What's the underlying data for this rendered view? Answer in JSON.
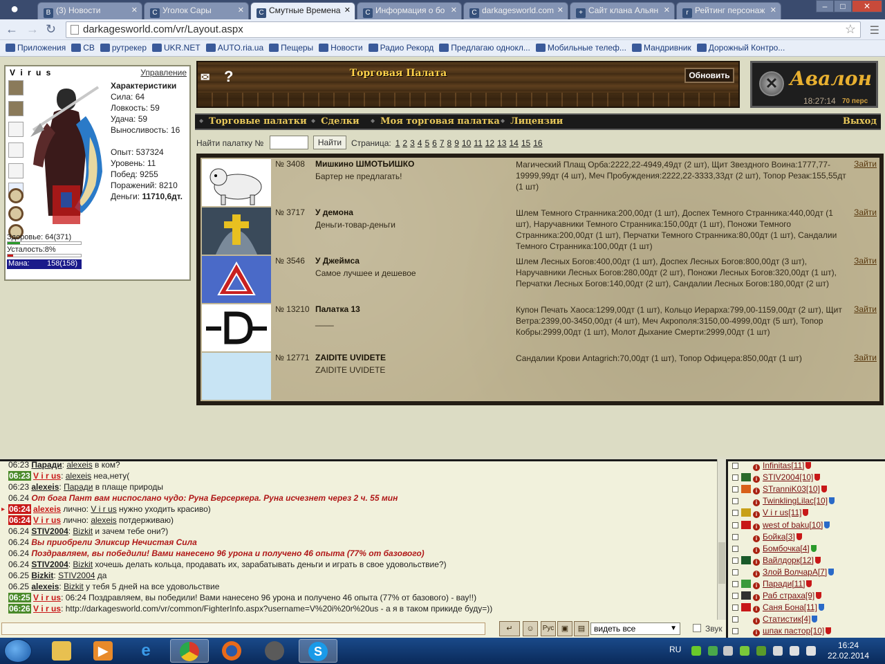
{
  "browser": {
    "tabs": [
      {
        "label": "(3) Новости",
        "fav": "B"
      },
      {
        "label": "Уголок Сары",
        "fav": "C"
      },
      {
        "label": "Смутные Времена",
        "fav": "C"
      },
      {
        "label": "Информация о бо",
        "fav": "C"
      },
      {
        "label": "darkagesworld.com",
        "fav": "C"
      },
      {
        "label": "Сайт клана Альян",
        "fav": "+"
      },
      {
        "label": "Рейтинг персонаж",
        "fav": "r"
      }
    ],
    "url": "darkagesworld.com/vr/Layout.aspx",
    "bookmarks": [
      "Приложения",
      "СВ",
      "рутрекер",
      "UKR.NET",
      "AUTO.ria.ua",
      "Пещеры",
      "Новости",
      "Радио Рекорд",
      "Предлагаю однокл...",
      "Мобильные телеф...",
      "Мандривник",
      "Дорожный Контро..."
    ]
  },
  "character": {
    "name": "V i r u s",
    "manage_label": "Управление",
    "stats_header": "Характеристики",
    "stats": [
      "Сила: 64",
      "Ловкость: 59",
      "Удача: 59",
      "Выносливость: 16"
    ],
    "progress": [
      "Опыт: 537324",
      "Уровень: 11",
      "Побед: 9255",
      "Поражений: 8210"
    ],
    "money_label": "Деньги: ",
    "money_value": "11710,6дт.",
    "health_label": "Здоровье:",
    "health_value": "64(371)",
    "health_fraction": 0.17,
    "fatigue_label": "Усталость:8%",
    "fatigue_fraction": 0.08,
    "mana_label": "Мана:",
    "mana_value": "158(158)",
    "colors": {
      "health": "#2a9a2a",
      "fatigue": "#c81818",
      "mana": "#1a1a8a"
    }
  },
  "header": {
    "title": "Торговая Палата",
    "refresh_label": "Обновить",
    "help_icon": "question-icon",
    "mail_icon": "letter-icon"
  },
  "server": {
    "name": "Авалон",
    "time": "18:27:14",
    "online": "70 перс"
  },
  "nav": {
    "items": [
      "Торговые палатки",
      "Сделки",
      "Моя торговая палатка",
      "Лицензии"
    ],
    "exit_label": "Выход"
  },
  "search": {
    "label": "Найти палатку №",
    "button_label": "Найти",
    "pages_label": "Страница:",
    "pages": [
      "1",
      "2",
      "3",
      "4",
      "5",
      "6",
      "7",
      "8",
      "9",
      "10",
      "11",
      "12",
      "13",
      "14",
      "15",
      "16"
    ]
  },
  "shops": [
    {
      "num": "№ 3408",
      "name": "Мишкино ШМОТЬИШКО",
      "motto": "Бартер не предлагать!",
      "goods": "Магический Плащ Орба:2222,22-4949,49дт (2 шт), Щит Звездного Воина:1777,77-19999,99дт (4 шт), Меч Пробуждения:2222,22-3333,33дт (2 шт), Топор Резак:155,55дт (1 шт)",
      "enter": "Зайти",
      "image": "bear-image"
    },
    {
      "num": "№ 3717",
      "name": "У демона",
      "motto": "Деньги-товар-деньги",
      "goods": "Шлем Темного Странника:200,00дт (1 шт), Доспех Темного Странника:440,00дт (1 шт), Наручавники Темного Странника:150,00дт (1 шт), Поножи Темного Странника:200,00дт (1 шт), Перчатки Темного Странника:80,00дт (1 шт), Сандалии Темного Странника:100,00дт (1 шт)",
      "enter": "Зайти",
      "image": "cross-knight-image"
    },
    {
      "num": "№ 3546",
      "name": "У Джеймса",
      "motto": "Самое лучшее и дешевое",
      "goods": "Шлем Лесных Богов:400,00дт (1 шт), Доспех Лесных Богов:800,00дт (3 шт), Наручавники Лесных Богов:280,00дт (2 шт), Поножи Лесных Богов:320,00дт (1 шт), Перчатки Лесных Богов:140,00дт (2 шт), Сандалии Лесных Богов:180,00дт (2 шт)",
      "enter": "Зайти",
      "image": "triangle-emblem-image"
    },
    {
      "num": "№ 13210",
      "name": "Палатка 13",
      "motto": "____",
      "goods": "Купон Печать Хаоса:1299,00дт (1 шт), Кольцо Иерарха:799,00-1159,00дт (2 шт), Щит Ветра:2399,00-3450,00дт (4 шт), Меч Акрополя:3150,00-4999,00дт (5 шт), Топор Кобры:2999,00дт (1 шт), Молот Дыхание Смерти:2999,00дт (1 шт)",
      "enter": "Зайти",
      "image": "letter-d-image"
    },
    {
      "num": "№ 12771",
      "name": "ZAIDITE UVIDETE",
      "motto": "ZAIDITE UVIDETE",
      "goods": "Сандалии Крови Antagrich:70,00дт (1 шт), Топор Офицера:850,00дт (1 шт)",
      "enter": "Зайти",
      "image": "blank-image"
    }
  ],
  "chat": [
    {
      "time": "06:23",
      "tcls": "",
      "parts": [
        [
          "n",
          "Паради"
        ],
        [
          "",
          ": "
        ],
        [
          "u",
          "alexeis"
        ],
        [
          "",
          " в ком?"
        ]
      ]
    },
    {
      "time": "06:23",
      "tcls": "g",
      "parts": [
        [
          "nr",
          "V i r us"
        ],
        [
          "",
          ": "
        ],
        [
          "u",
          "alexeis"
        ],
        [
          "",
          " неа,нету("
        ]
      ]
    },
    {
      "time": "06:23",
      "tcls": "",
      "parts": [
        [
          "n",
          "alexeis"
        ],
        [
          "",
          ": "
        ],
        [
          "u",
          "Паради"
        ],
        [
          "",
          " в плаще природы"
        ]
      ]
    },
    {
      "time": "06.24",
      "tcls": "",
      "parts": [
        [
          "sys",
          "От бога Пант вам ниспослано чудо: Руна Берсеркера. Руна исчезнет через 2 ч. 55 мин"
        ]
      ]
    },
    {
      "time": "06:24",
      "tcls": "r",
      "arrow": true,
      "parts": [
        [
          "nr",
          "alexeis"
        ],
        [
          "",
          " лично: "
        ],
        [
          "u",
          "V i r us"
        ],
        [
          "",
          " нужно уходить красиво)"
        ]
      ]
    },
    {
      "time": "06:24",
      "tcls": "r",
      "parts": [
        [
          "nr",
          "V i r us"
        ],
        [
          "",
          " лично: "
        ],
        [
          "u",
          "alexeis"
        ],
        [
          "",
          " потдерживаю)"
        ]
      ]
    },
    {
      "time": "06.24",
      "tcls": "",
      "parts": [
        [
          "n",
          "STIV2004"
        ],
        [
          "",
          ": "
        ],
        [
          "u",
          "Bizkit"
        ],
        [
          "",
          " и зачем тебе они?)"
        ]
      ]
    },
    {
      "time": "06.24",
      "tcls": "",
      "parts": [
        [
          "sys",
          "Вы приобрели Эликсир Нечистая Сила"
        ]
      ]
    },
    {
      "time": "06.24",
      "tcls": "",
      "parts": [
        [
          "sys",
          "Поздравляем, вы победили! Вами нанесено 96 урона и получено 46 опыта (77% от базового)"
        ]
      ]
    },
    {
      "time": "06.24",
      "tcls": "",
      "parts": [
        [
          "n",
          "STIV2004"
        ],
        [
          "",
          ": "
        ],
        [
          "u",
          "Bizkit"
        ],
        [
          "",
          " хочешь делать кольца, продавать их, зарабатывать деньги и играть в свое удовольствие?)"
        ]
      ]
    },
    {
      "time": "06.25",
      "tcls": "",
      "parts": [
        [
          "n",
          "Bizkit"
        ],
        [
          "",
          ": "
        ],
        [
          "u",
          "STIV2004"
        ],
        [
          "",
          " да"
        ]
      ]
    },
    {
      "time": "06.25",
      "tcls": "",
      "parts": [
        [
          "n",
          "alexeis"
        ],
        [
          "",
          ": "
        ],
        [
          "u",
          "Bizkit"
        ],
        [
          "",
          " у тебя 5 дней на все удовольствие"
        ]
      ]
    },
    {
      "time": "06:25",
      "tcls": "g",
      "parts": [
        [
          "nr",
          "V i r us"
        ],
        [
          "",
          ": 06:24 Поздравляем, вы победили! Вами нанесено 96 урона и получено 46 опыта (77% от базового) - вау!!)"
        ]
      ]
    },
    {
      "time": "06:26",
      "tcls": "g",
      "parts": [
        [
          "nr",
          "V i r us"
        ],
        [
          "",
          ": http://darkagesworld.com/vr/common/FighterInfo.aspx?username=V%20i%20r%20us - а я в таком прикиде буду=))"
        ]
      ]
    }
  ],
  "chatbar": {
    "buttons": [
      "↵",
      "☺",
      "Рус",
      "▣",
      "▤"
    ],
    "filter_value": "видеть все",
    "sound_label": "Звук"
  },
  "online": [
    {
      "name": "Infinitas[11]",
      "clan": "",
      "shield": "#c81818"
    },
    {
      "name": "STIV2004[10]",
      "clan": "#2a6a2a",
      "shield": "#c81818"
    },
    {
      "name": "STranniK03[10]",
      "clan": "#d8601a",
      "shield": "#c81818"
    },
    {
      "name": "TwinklingLilac[10]",
      "clan": "",
      "shield": "#2a6ac8"
    },
    {
      "name": "V i r us[11]",
      "clan": "#c8a018",
      "shield": "#c81818"
    },
    {
      "name": "west of baku[10]",
      "clan": "#c81818",
      "shield": "#2a6ac8"
    },
    {
      "name": "Бойка[3]",
      "clan": "",
      "shield": "#c81818"
    },
    {
      "name": "Бомбочка[4]",
      "clan": "",
      "shield": "#2a9a2a"
    },
    {
      "name": "Вайлдорк[12]",
      "clan": "#1a5a2a",
      "shield": "#c81818"
    },
    {
      "name": "Злой ВолчарА[7]",
      "clan": "",
      "shield": "#2a6ac8"
    },
    {
      "name": "Паради[11]",
      "clan": "#3a9a3a",
      "shield": "#c81818"
    },
    {
      "name": "Раб страха[9]",
      "clan": "#303030",
      "shield": "#c81818"
    },
    {
      "name": "Саня Бона[11]",
      "clan": "#c81818",
      "shield": "#2a6ac8"
    },
    {
      "name": "Статистик[4]",
      "clan": "",
      "shield": "#2a6ac8"
    },
    {
      "name": "шпак пастор[10]",
      "clan": "",
      "shield": "#c81818"
    }
  ],
  "taskbar": {
    "lang": "RU",
    "time": "16:24",
    "date": "22.02.2014"
  }
}
